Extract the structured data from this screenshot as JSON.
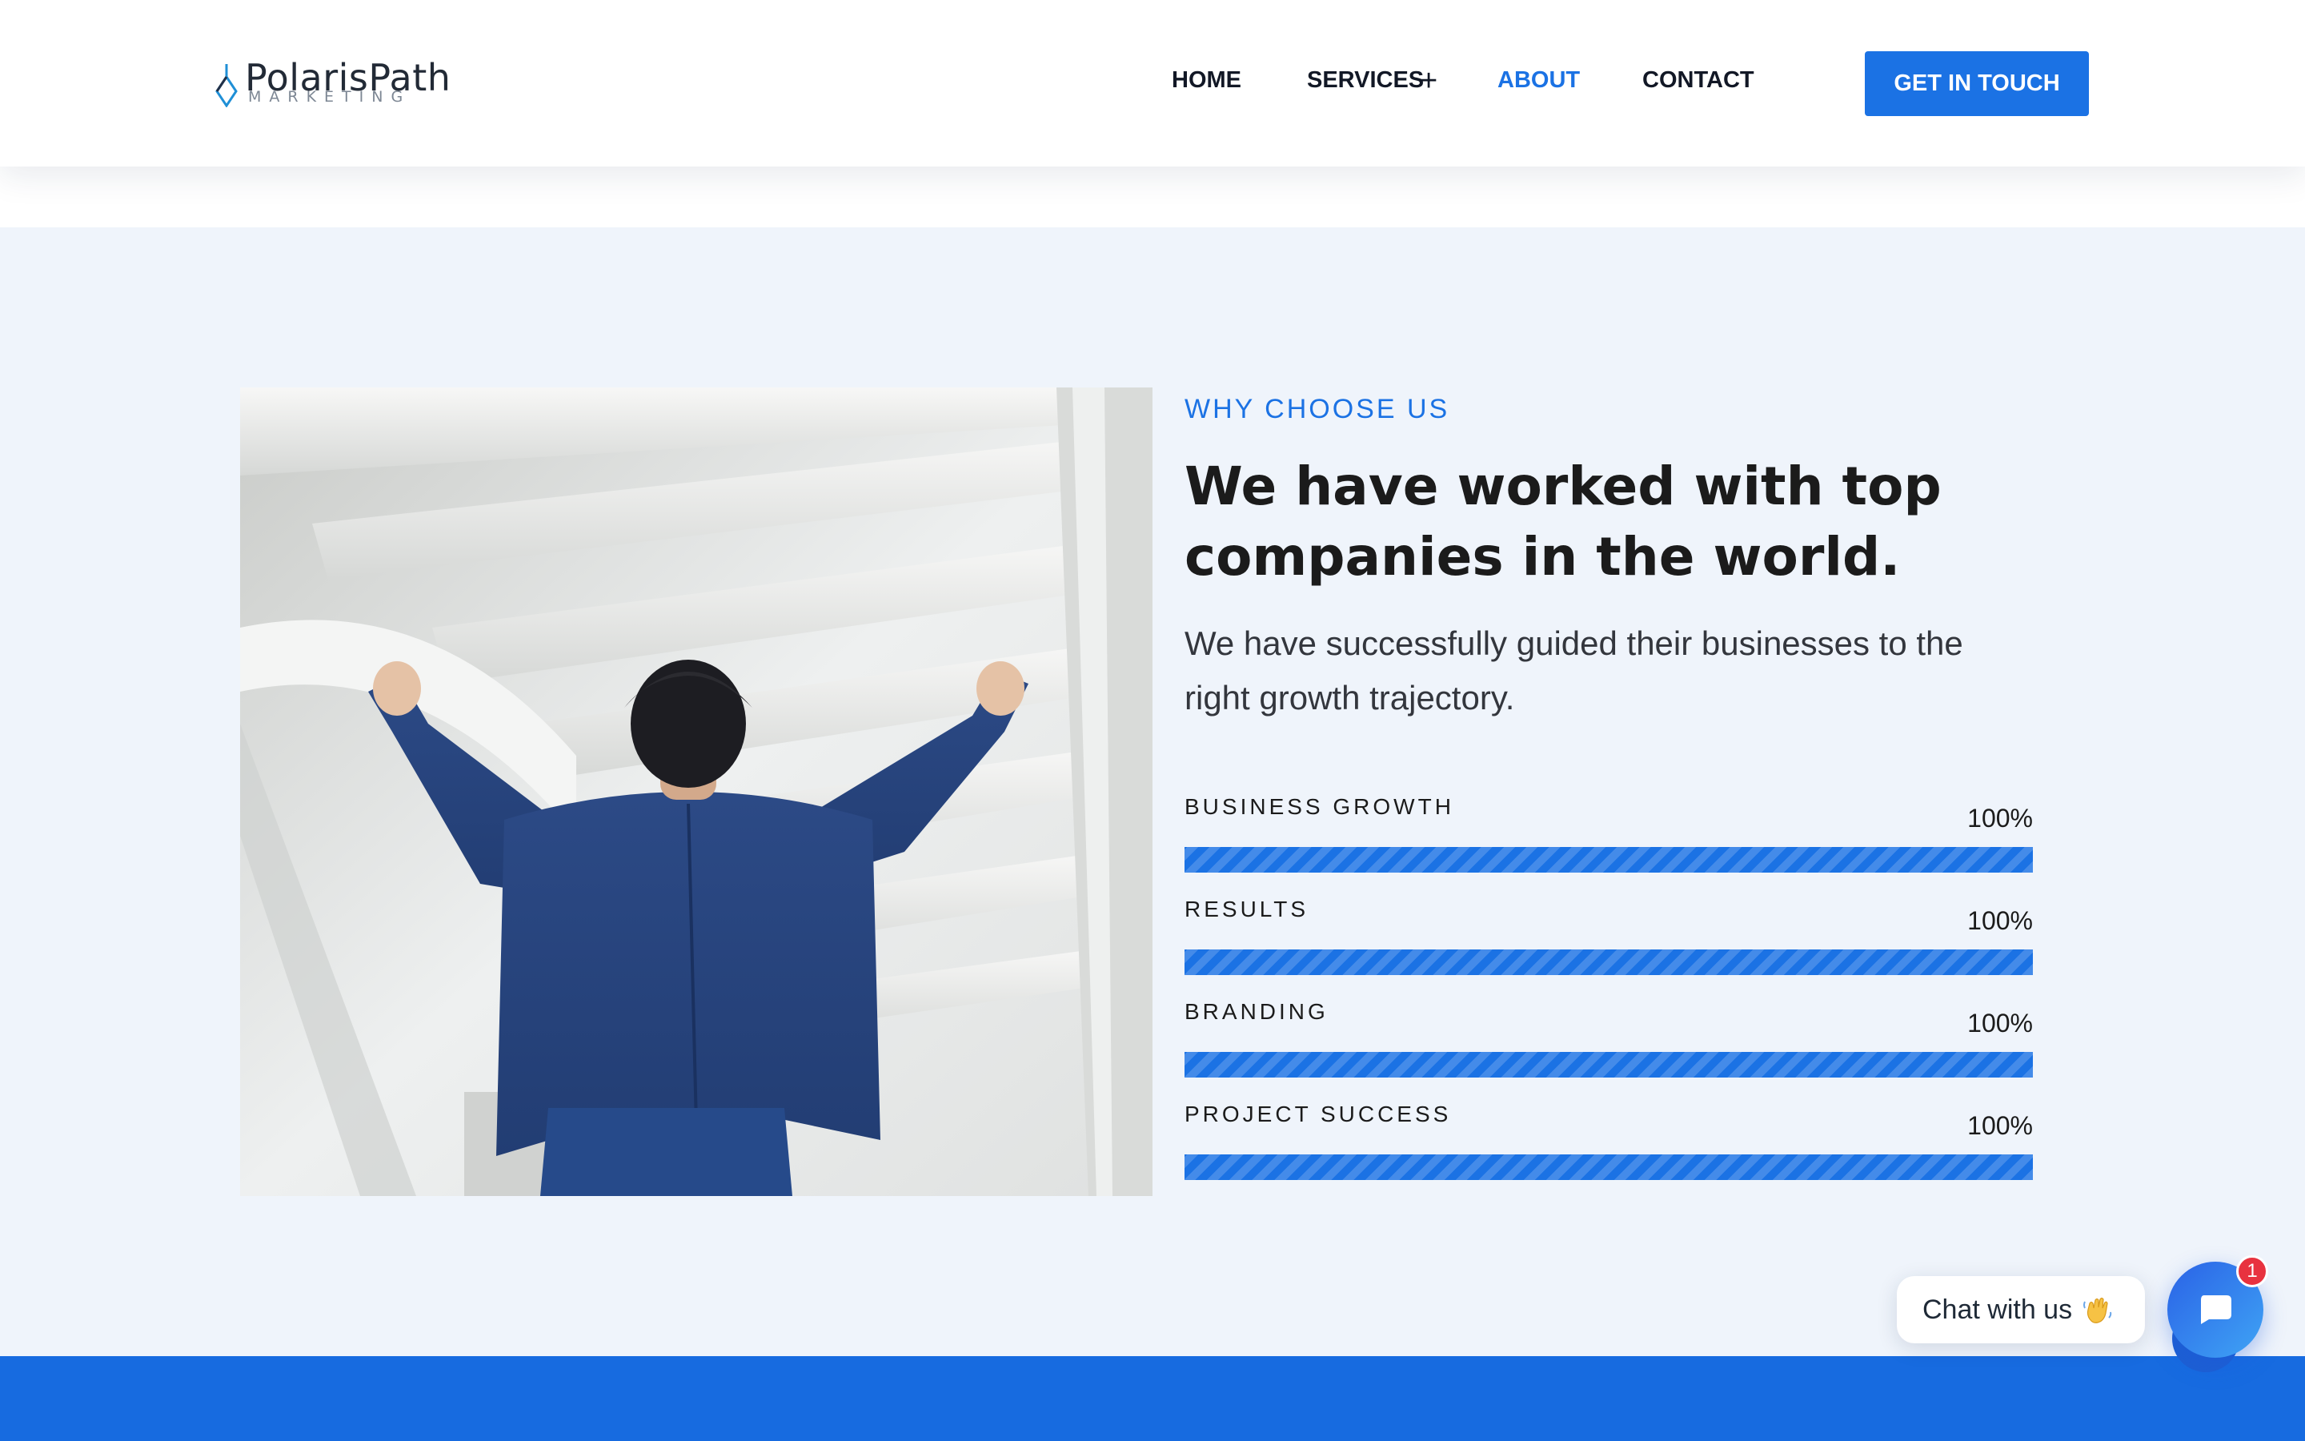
{
  "brand": {
    "name": "PolarisPath",
    "tagline": "MARKETING",
    "color": "#1b72e4"
  },
  "nav": {
    "items": [
      {
        "label": "HOME"
      },
      {
        "label": "SERVICES",
        "has_submenu": true,
        "submenu_icon": "plus-icon"
      },
      {
        "label": "ABOUT",
        "active": true
      },
      {
        "label": "CONTACT"
      }
    ],
    "cta_label": "GET IN TOUCH"
  },
  "about": {
    "eyebrow": "WHY CHOOSE US",
    "headline": "We have worked with top companies in the world.",
    "lead": "We have successfully guided their businesses to the right growth trajectory.",
    "image_alt": "Businessman in blue suit raising both fists under white arched structure",
    "skills": [
      {
        "label": "BUSINESS GROWTH",
        "percent_text": "100%",
        "value": 100
      },
      {
        "label": "RESULTS",
        "percent_text": "100%",
        "value": 100
      },
      {
        "label": "BRANDING",
        "percent_text": "100%",
        "value": 100
      },
      {
        "label": "PROJECT SUCCESS",
        "percent_text": "100%",
        "value": 100
      }
    ]
  },
  "chat": {
    "label": "Chat with us",
    "wave_icon": "waving-hand-icon",
    "badge_count": "1",
    "button_icon": "chat-icon"
  },
  "colors": {
    "accent": "#1b72e4",
    "section_bg": "#eff4fb",
    "band": "#176be0",
    "badge": "#e8323f"
  }
}
